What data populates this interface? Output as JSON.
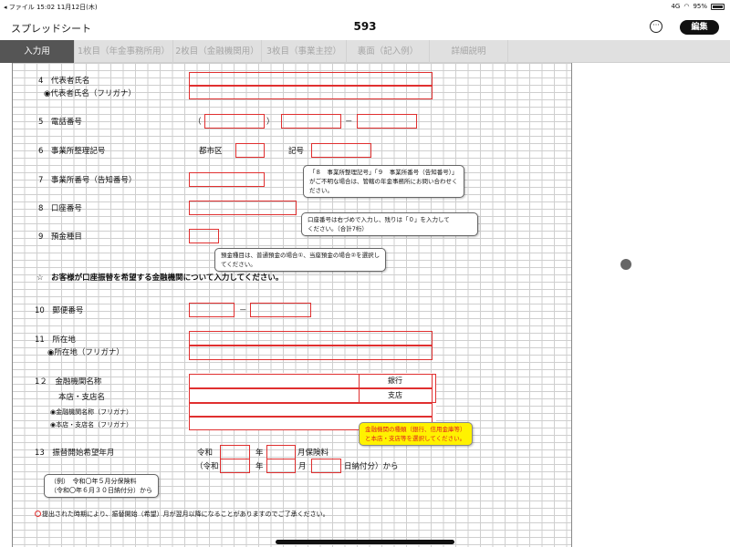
{
  "status_bar": {
    "left": "◂ ファイル  15:02  11月12日(木)",
    "signal": "4G",
    "battery": "95%"
  },
  "nav": {
    "back_label": "スプレッドシート",
    "title": "593",
    "more_label": "···",
    "edit_label": "編集"
  },
  "tabs": [
    {
      "label": "入力用",
      "active": true
    },
    {
      "label": "1枚目（年金事務所用）",
      "active": false
    },
    {
      "label": "2枚目（金融機関用）",
      "active": false
    },
    {
      "label": "3枚目（事業主控）",
      "active": false
    },
    {
      "label": "裏面（記入例）",
      "active": false
    },
    {
      "label": "詳細説明",
      "active": false
    }
  ],
  "form": {
    "r4_label": "4　代表者氏名",
    "r4_sub": "◉代表者氏名（フリガナ）",
    "r5_label": "5　電話番号",
    "r5_open": "（",
    "r5_close": "）",
    "r5_dash": "－",
    "r6_label": "6　事業所整理記号",
    "r6_city": "都市区",
    "r6_code": "記号",
    "r7_label": "7　事業所番号（告知番号）",
    "r8_label": "8　口座番号",
    "r9_label": "9　預金種目",
    "section_star": "☆　お客様が口座振替を希望する金融機関について入力してください。",
    "r10_label": "10　郵便番号",
    "r10_dash": "－",
    "r11_label": "11　所在地",
    "r11_sub": "◉所在地（フリガナ）",
    "r12_label": "1２　金融機関名称",
    "r12_sub1": "本店・支店名",
    "r12_sub2": "◉金融機関名称（フリガナ）",
    "r12_sub3": "◉本店・支店名（フリガナ）",
    "r12_bank": "銀行",
    "r12_branch": "支店",
    "r13_label": "13　振替開始希望年月",
    "r13_reiwa": "令和",
    "r13_year": "年",
    "r13_month_fee": "月保険料",
    "r13_reiwa2": "（令和",
    "r13_year2": "年",
    "r13_month2": "月",
    "r13_day_from": "日納付分）から"
  },
  "callouts": {
    "c1": [
      "「８　事業所整理記号」「９　事業所番号（告知番号）」",
      "がご不明な場合は、管轄の年金事務所にお問い合わせく",
      "ださい。"
    ],
    "c2": [
      "口座番号は右づめで入力し、残りは「０」を入力して",
      "ください。（合計7桁）"
    ],
    "c3": [
      "預金種目は、普通預金の場合①、当座預金の場合②を選択し",
      "てください。"
    ],
    "c4": [
      "金融機関の種類（銀行、信用金庫等）",
      "と本店・支店等を選択してください。"
    ],
    "c5": [
      "（例）　令和〇年５月分保険料",
      "（令和〇年６月３０日納付分）から"
    ]
  },
  "footnote": "提出された時期により、振替開始（希望）月が翌月以降になることがありますのでご了承ください。",
  "colors": {
    "accent_red": "#e03030",
    "callout_yellow": "#fff200",
    "tab_active": "#555555"
  }
}
